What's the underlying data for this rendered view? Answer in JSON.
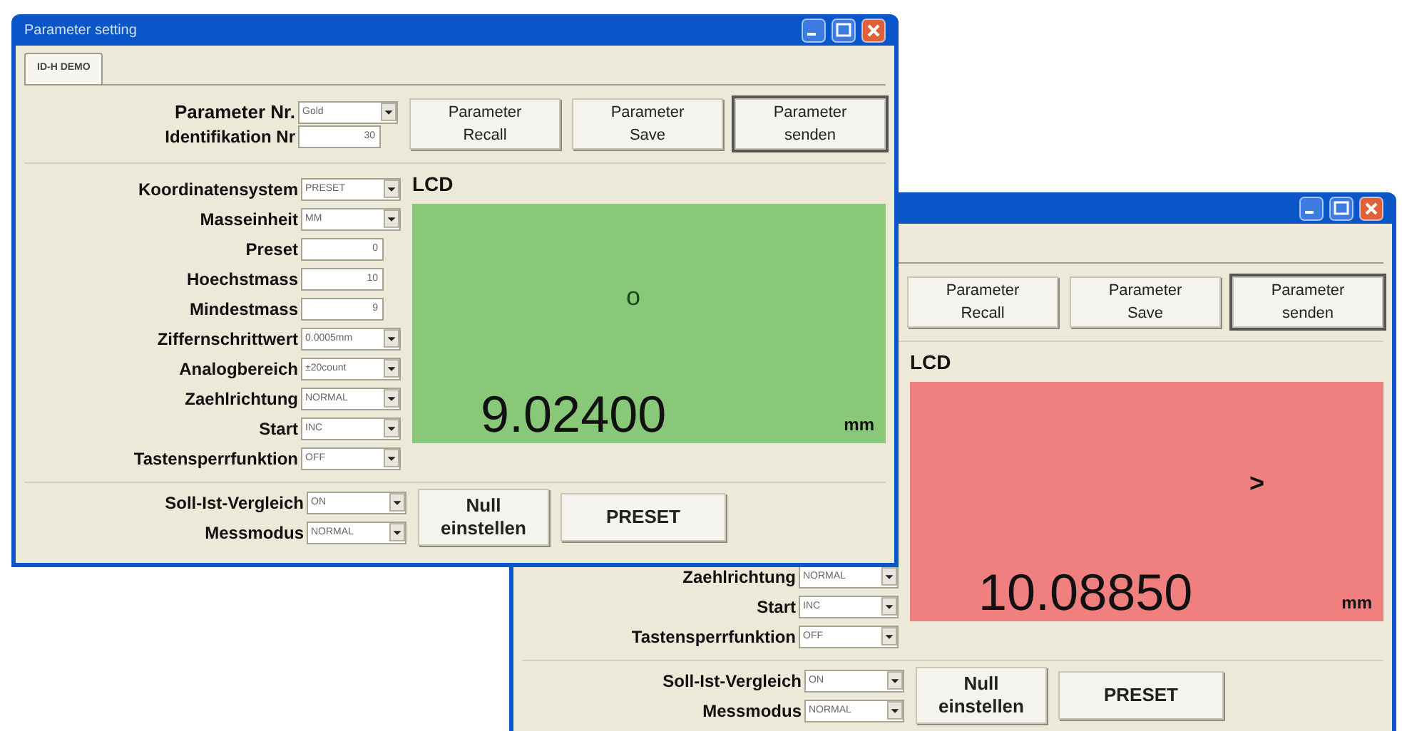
{
  "windows": [
    {
      "title": "Parameter setting",
      "tabs": [
        {
          "label": "ID-H DEMO",
          "selected": true
        }
      ],
      "header_fields": [
        {
          "label": "Parameter Nr.",
          "kind": "dropdown",
          "value": "Gold"
        },
        {
          "label": "Identifikation Nr",
          "kind": "textbox",
          "value": "30"
        }
      ],
      "buttons": [
        {
          "label": "Parameter\nRecall",
          "default": false
        },
        {
          "label": "Parameter\nSave",
          "default": false
        },
        {
          "label": "Parameter\nsenden",
          "default": true
        }
      ],
      "lcd": {
        "label": "LCD",
        "color": "#88c878",
        "indicator": "o",
        "reading": "9.02400",
        "unit": "mm"
      },
      "parameters": [
        {
          "label": "Koordinatensystem",
          "kind": "dropdown",
          "value": "PRESET"
        },
        {
          "label": "Masseinheit",
          "kind": "dropdown",
          "value": "MM"
        },
        {
          "label": "Preset",
          "kind": "textbox",
          "value": "0"
        },
        {
          "label": "Hoechstmass",
          "kind": "textbox",
          "value": "10"
        },
        {
          "label": "Mindestmass",
          "kind": "textbox",
          "value": "9"
        },
        {
          "label": "Ziffernschrittwert",
          "kind": "dropdown",
          "value": "0.0005mm"
        },
        {
          "label": "Analogbereich",
          "kind": "dropdown",
          "value": "±20count"
        },
        {
          "label": "Zaehlrichtung",
          "kind": "dropdown",
          "value": "NORMAL"
        },
        {
          "label": "Start",
          "kind": "dropdown",
          "value": "INC"
        },
        {
          "label": "Tastensperrfunktion",
          "kind": "dropdown",
          "value": "OFF"
        }
      ],
      "comparison_fields": [
        {
          "label": "Soll-Ist-Vergleich",
          "kind": "dropdown",
          "value": "ON"
        },
        {
          "label": "Messmodus",
          "kind": "dropdown",
          "value": "NORMAL"
        }
      ],
      "actions": [
        "Null\neinstellen",
        "PRESET"
      ]
    },
    {
      "buttons": [
        {
          "label": "Parameter\nRecall",
          "default": false
        },
        {
          "label": "Parameter\nSave",
          "default": false
        },
        {
          "label": "Parameter\nsenden",
          "default": true
        }
      ],
      "lcd": {
        "label": "LCD",
        "color": "#f08080",
        "indicator": ">",
        "reading": "10.08850",
        "unit": "mm"
      },
      "parameters": [
        {
          "label": "Zaehlrichtung",
          "kind": "dropdown",
          "value": "NORMAL"
        },
        {
          "label": "Start",
          "kind": "dropdown",
          "value": "INC"
        },
        {
          "label": "Tastensperrfunktion",
          "kind": "dropdown",
          "value": "OFF"
        }
      ],
      "comparison_fields": [
        {
          "label": "Soll-Ist-Vergleich",
          "kind": "dropdown",
          "value": "ON"
        },
        {
          "label": "Messmodus",
          "kind": "dropdown",
          "value": "NORMAL"
        }
      ],
      "actions": [
        "Null\neinstellen",
        "PRESET"
      ]
    }
  ]
}
